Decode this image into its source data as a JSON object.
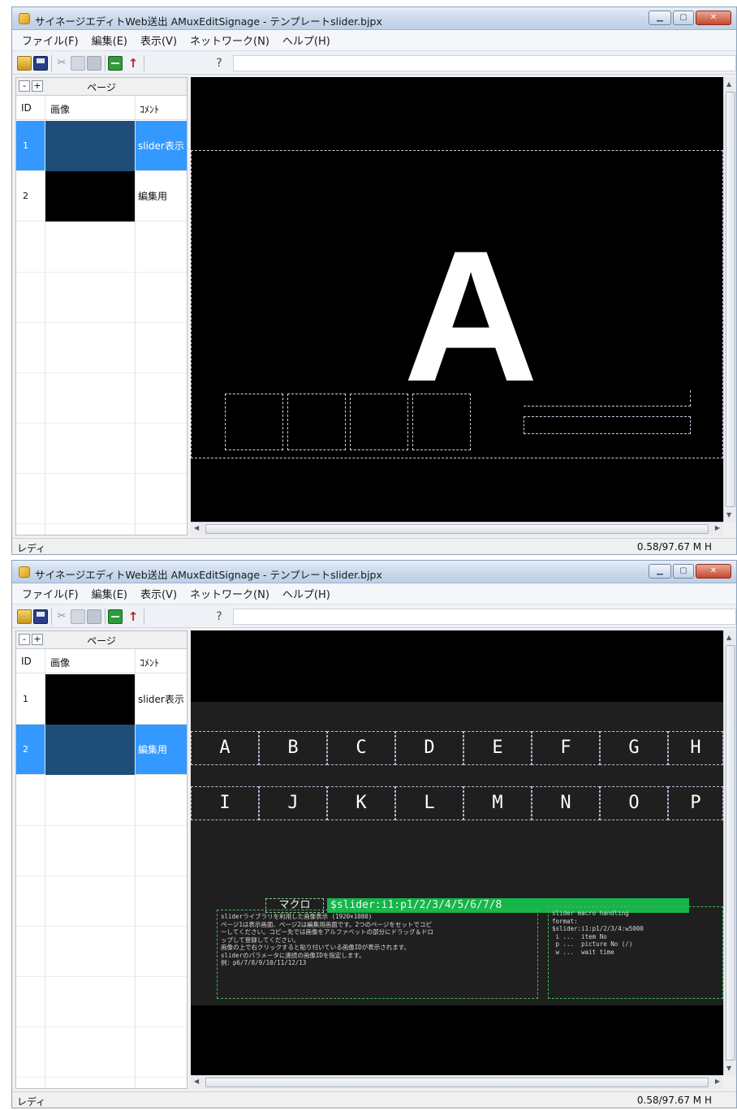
{
  "windows": [
    {
      "title": "サイネージエディトWeb送出 AMuxEditSignage - テンプレートslider.bjpx",
      "menu": [
        "ファイル(F)",
        "編集(E)",
        "表示(V)",
        "ネットワーク(N)",
        "ヘルプ(H)"
      ],
      "panel": {
        "title": "ページ",
        "minus": "-",
        "plus": "+",
        "columns": [
          "ID",
          "画像",
          "ｺﾒﾝﾄ"
        ],
        "rows": [
          {
            "id": "1",
            "comment": "slider表示",
            "selected": true
          },
          {
            "id": "2",
            "comment": "編集用",
            "selected": false
          }
        ]
      },
      "canvas": {
        "big_letter": "A"
      },
      "status": {
        "left": "レディ",
        "right": "0.58/97.67 M  H"
      }
    },
    {
      "title": "サイネージエディトWeb送出 AMuxEditSignage - テンプレートslider.bjpx",
      "menu": [
        "ファイル(F)",
        "編集(E)",
        "表示(V)",
        "ネットワーク(N)",
        "ヘルプ(H)"
      ],
      "panel": {
        "title": "ページ",
        "minus": "-",
        "plus": "+",
        "columns": [
          "ID",
          "画像",
          "ｺﾒﾝﾄ"
        ],
        "rows": [
          {
            "id": "1",
            "comment": "slider表示",
            "selected": false
          },
          {
            "id": "2",
            "comment": "編集用",
            "selected": true
          }
        ]
      },
      "canvas": {
        "letters_row1": [
          "A",
          "B",
          "C",
          "D",
          "E",
          "F",
          "G",
          "H"
        ],
        "letters_row2": [
          "I",
          "J",
          "K",
          "L",
          "M",
          "N",
          "O",
          "P"
        ],
        "macro_label": "マクロ",
        "macro_code": "$slider:i1:p1/2/3/4/5/6/7/8",
        "note_left": "sliderライブラリを利用した画像表示 (1920×1080)\nページ1は表示画面、ページ2は編集用画面です。2つのページをセットでコピ\nーしてください。コピー先では画像をアルファベットの部分にドラッグ＆ドロ\nップして登録してください。\n画像の上で右クリックすると貼り付いている画像IDが表示されます。\nsliderのパラメータに連続の画像IDを指定します。\n例：p6/7/8/9/10/11/12/13",
        "note_right": "slider macro handling\nformat:\n$slider:i1:p1/2/3/4:w5000\n i ...  item No\n p ...  picture No (/)\n w ...  wait time"
      },
      "status": {
        "left": "レディ",
        "right": "0.58/97.67 M  H"
      }
    }
  ],
  "colors": {
    "selected_row": "#3399ff",
    "macro_green": "#16b54a",
    "canvas": "#000000"
  }
}
